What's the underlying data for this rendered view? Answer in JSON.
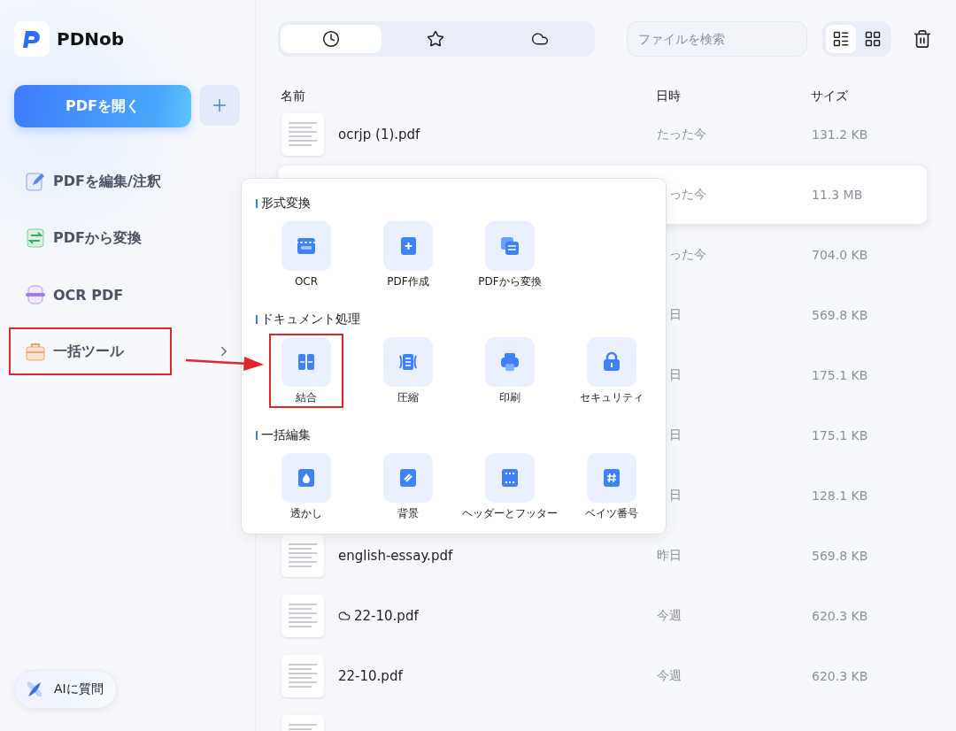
{
  "app": {
    "name": "PDNob"
  },
  "sidebar": {
    "open_button": "PDFを開く",
    "nav_items": [
      {
        "label": "PDFを編集/注釈",
        "highlighted": false,
        "expandable": false
      },
      {
        "label": "PDFから変換",
        "highlighted": false,
        "expandable": false
      },
      {
        "label": "OCR PDF",
        "highlighted": false,
        "expandable": false
      },
      {
        "label": "一括ツール",
        "highlighted": true,
        "expandable": true
      }
    ],
    "ai_button": "AIに質問"
  },
  "toolbar": {
    "tabs": [
      {
        "selected": true
      },
      {
        "selected": false
      },
      {
        "selected": false
      }
    ],
    "search": {
      "placeholder": "ファイルを検索"
    },
    "view_modes": [
      {
        "selected": true
      },
      {
        "selected": false
      }
    ]
  },
  "table": {
    "columns": [
      "名前",
      "日時",
      "サイズ"
    ],
    "rows": [
      {
        "name": "ocrjp (1).pdf",
        "date": "たった今",
        "size": "131.2 KB",
        "covered": false
      },
      {
        "date": "った今",
        "size": "11.3 MB",
        "hovered": true,
        "covered": true
      },
      {
        "date": "った今",
        "size": "704.0 KB",
        "covered": true
      },
      {
        "date": "日",
        "size": "569.8 KB",
        "covered": true
      },
      {
        "date": "日",
        "size": "175.1 KB",
        "covered": true
      },
      {
        "date": "日",
        "size": "175.1 KB",
        "covered": true
      },
      {
        "date": "日",
        "size": "128.1 KB",
        "covered": true
      },
      {
        "name": "english-essay.pdf",
        "date": "昨日",
        "size": "569.8 KB",
        "covered": false
      },
      {
        "name": "22-10.pdf",
        "date": "今週",
        "size": "620.3 KB",
        "covered": false,
        "cloud": true
      },
      {
        "name": "22-10.pdf",
        "date": "今週",
        "size": "620.3 KB",
        "covered": false
      },
      {
        "covered": false
      }
    ]
  },
  "tools_menu": {
    "sections": [
      {
        "title": "形式変換",
        "items": [
          {
            "label": "OCR",
            "highlighted": false
          },
          {
            "label": "PDF作成",
            "highlighted": false
          },
          {
            "label": "PDFから変換",
            "highlighted": false
          }
        ]
      },
      {
        "title": "ドキュメント処理",
        "items": [
          {
            "label": "結合",
            "highlighted": true
          },
          {
            "label": "圧縮",
            "highlighted": false
          },
          {
            "label": "印刷",
            "highlighted": false
          },
          {
            "label": "セキュリティ",
            "highlighted": false
          }
        ]
      },
      {
        "title": "一括編集",
        "items": [
          {
            "label": "透かし",
            "highlighted": false
          },
          {
            "label": "背景",
            "highlighted": false
          },
          {
            "label": "ヘッダーとフッター",
            "highlighted": false
          },
          {
            "label": "ベイツ番号",
            "highlighted": false
          }
        ]
      }
    ]
  }
}
